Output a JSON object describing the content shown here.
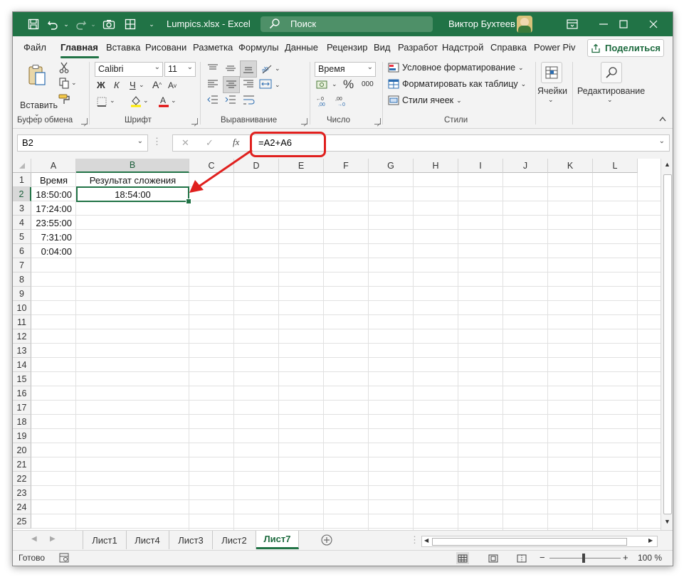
{
  "window": {
    "title": "Lumpics.xlsx  -  Excel",
    "search_label": "Поиск",
    "user_name": "Виктор Бухтеев"
  },
  "tabs": [
    "Файл",
    "Главная",
    "Вставка",
    "Рисовани",
    "Разметка",
    "Формулы",
    "Данные",
    "Рецензир",
    "Вид",
    "Разработ",
    "Надстрой",
    "Справка",
    "Power Piv"
  ],
  "active_tab": "Главная",
  "share_label": "Поделиться",
  "ribbon": {
    "clipboard": {
      "paste_label": "Вставить",
      "group_label": "Буфер обмена"
    },
    "font": {
      "font_name": "Calibri",
      "font_size": "11",
      "bold": "Ж",
      "italic": "К",
      "underline": "Ч",
      "group_label": "Шрифт"
    },
    "alignment": {
      "group_label": "Выравнивание"
    },
    "number": {
      "format": "Время",
      "percent": "%",
      "thousands": "000",
      "group_label": "Число"
    },
    "styles": {
      "conditional": "Условное форматирование",
      "as_table": "Форматировать как таблицу",
      "cell_styles": "Стили ячеек",
      "group_label": "Стили"
    },
    "cells": {
      "label": "Ячейки"
    },
    "editing": {
      "label": "Редактирование"
    }
  },
  "formula_bar": {
    "name_box": "B2",
    "fx": "fx",
    "formula": "=A2+A6"
  },
  "grid": {
    "columns": [
      "A",
      "B",
      "C",
      "D",
      "E",
      "F",
      "G",
      "H",
      "I",
      "J",
      "K",
      "L"
    ],
    "rows": [
      "1",
      "2",
      "3",
      "4",
      "5",
      "6",
      "7",
      "8",
      "9",
      "10",
      "11",
      "12",
      "13",
      "14",
      "15",
      "16",
      "17",
      "18",
      "19",
      "20",
      "21",
      "22",
      "23",
      "24",
      "25"
    ],
    "selected_cell": "B2",
    "cells": {
      "A1": "Время",
      "B1": "Результат сложения",
      "A2": "18:50:00",
      "B2": "18:54:00",
      "A3": "17:24:00",
      "A4": "23:55:00",
      "A5": "7:31:00",
      "A6": "0:04:00"
    }
  },
  "sheets": [
    "Лист1",
    "Лист4",
    "Лист3",
    "Лист2",
    "Лист7"
  ],
  "active_sheet": "Лист7",
  "status": {
    "ready": "Готово",
    "zoom": "100 %",
    "zoom_minus": "−",
    "zoom_plus": "+"
  },
  "colors": {
    "excel_green": "#217346",
    "annotation_red": "#e0201e"
  }
}
